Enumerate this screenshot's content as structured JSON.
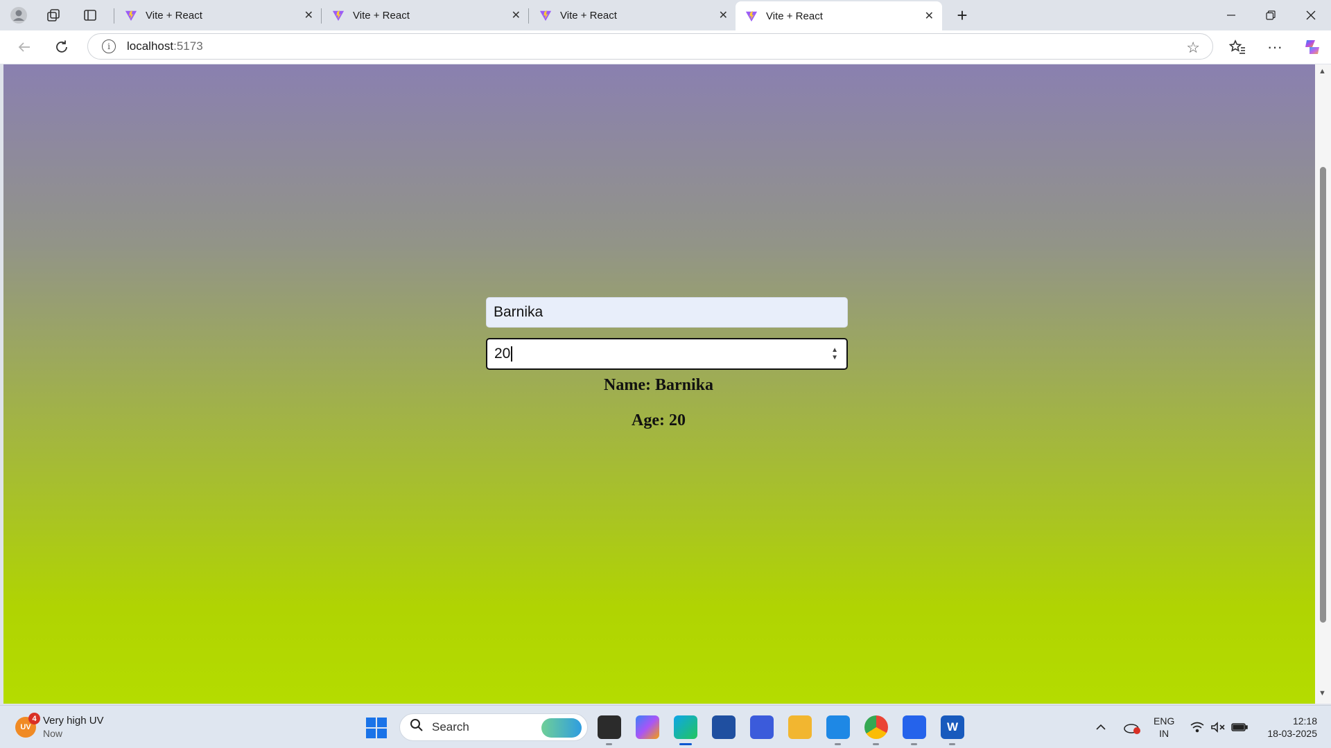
{
  "browser": {
    "tabs": [
      {
        "title": "Vite + React"
      },
      {
        "title": "Vite + React"
      },
      {
        "title": "Vite + React"
      },
      {
        "title": "Vite + React"
      }
    ],
    "url_host": "localhost",
    "url_port": ":5173"
  },
  "page": {
    "name_value": "Barnika",
    "age_value": "20",
    "name_output": "Name: Barnika",
    "age_output": "Age: 20"
  },
  "taskbar": {
    "weather_title": "Very high UV",
    "weather_sub": "Now",
    "uv_label": "UV",
    "uv_badge": "4",
    "search_label": "Search",
    "lang_top": "ENG",
    "lang_bottom": "IN",
    "time": "12:18",
    "date": "18-03-2025"
  },
  "colors": {
    "gradient_top": "#8a80b0",
    "gradient_bottom": "#b4dc00",
    "edge_accent": "#0b57d0"
  },
  "icons": [
    "profile-icon",
    "workspaces-icon",
    "tab-actions-icon",
    "vite-logo-icon",
    "close-icon",
    "plus-icon",
    "minimize-icon",
    "restore-icon",
    "back-icon",
    "reload-icon",
    "info-icon",
    "star-icon",
    "favorites-icon",
    "more-icon",
    "copilot-icon",
    "windows-start-icon",
    "search-icon"
  ]
}
